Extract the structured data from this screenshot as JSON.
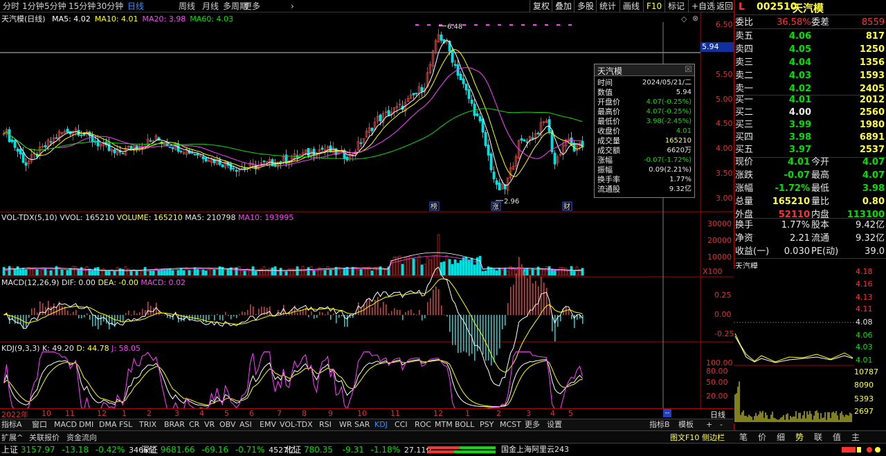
{
  "period_tabs": [
    "分时",
    "1分钟",
    "5分钟",
    "15分钟",
    "30分钟",
    "日线",
    "周线",
    "月线",
    "多周期",
    "更多"
  ],
  "active_period": "日线",
  "right_buttons": [
    "复权",
    "叠加",
    "多股",
    "统计",
    "画线",
    "F10",
    "标记",
    "+自选",
    "返回"
  ],
  "highlight_button": "F10",
  "header": {
    "flag": "L",
    "code": "002510",
    "name": "天汽模"
  },
  "price_chart": {
    "title": "天汽模(日线)",
    "ma": [
      {
        "label": "MA5: 4.02",
        "color": "#ffffff"
      },
      {
        "label": "MA10: 4.01",
        "color": "#ffff00"
      },
      {
        "label": "MA20: 3.98",
        "color": "#ff40ff"
      },
      {
        "label": "MA60: 4.03",
        "color": "#00e000"
      }
    ],
    "y_ticks": [
      "6.50",
      "6.00",
      "5.50",
      "5.00",
      "4.50",
      "4.00",
      "3.50",
      "3.00"
    ],
    "crosshair_value": "5.94",
    "high_marker": "6.48",
    "low_marker": "2.96",
    "event_marks": [
      "榜",
      "涨",
      "财"
    ]
  },
  "volume_chart": {
    "title": "VOL-TDX(5,10)",
    "vvol": "VVOL: 165210",
    "volume": "VOLUME: 165210",
    "ma5": "MA5: 210798",
    "ma10": "MA10: 193995",
    "y_ticks": [
      "30000",
      "20000",
      "10000"
    ],
    "unit": "X100"
  },
  "macd_chart": {
    "title": "MACD(12,26,9)",
    "dif": "DIF: 0.00",
    "dea": "DEA: -0.00",
    "macd": "MACD: 0.02",
    "y_ticks": [
      "0.25",
      "0.00",
      "-0.25"
    ]
  },
  "kdj_chart": {
    "title": "KDJ(9,3,3)",
    "k": "K: 49.20",
    "d": "D: 44.78",
    "j": "J: 58.05",
    "y_ticks": [
      "100.00",
      "80.00",
      "50.00",
      "20.00"
    ]
  },
  "date_axis": [
    "2022年",
    "10",
    "11",
    "12",
    "1",
    "2",
    "3",
    "4",
    "5",
    "6",
    "7",
    "8",
    "9",
    "10",
    "11",
    "12",
    "1",
    "2",
    "3",
    "4",
    "5"
  ],
  "date_axis_right": "日线",
  "tooltip": {
    "title": "天汽模",
    "rows": [
      {
        "k": "时间",
        "v": "2024/05/21/二",
        "c": "#e8e8e8"
      },
      {
        "k": "数值",
        "v": "5.94",
        "c": "#e8e8e8"
      },
      {
        "k": "开盘价",
        "v": "4.07(-0.25%)",
        "c": "#00e000"
      },
      {
        "k": "最高价",
        "v": "4.07(-0.25%)",
        "c": "#00e000"
      },
      {
        "k": "最低价",
        "v": "3.98(-2.45%)",
        "c": "#00e000"
      },
      {
        "k": "收盘价",
        "v": "4.01",
        "c": "#00e000"
      },
      {
        "k": "成交量",
        "v": "165210",
        "c": "#ffff40"
      },
      {
        "k": "成交额",
        "v": "6620万",
        "c": "#e8e8e8"
      },
      {
        "k": "涨幅",
        "v": "-0.07(-1.72%)",
        "c": "#00e000"
      },
      {
        "k": "振幅",
        "v": "0.09(2.21%)",
        "c": "#e8e8e8"
      },
      {
        "k": "换手率",
        "v": "1.77%",
        "c": "#e8e8e8"
      },
      {
        "k": "流通股",
        "v": "9.32亿",
        "c": "#e8e8e8"
      }
    ]
  },
  "quote": {
    "weibi_label": "委比",
    "weibi": "36.58%",
    "weicha_label": "委差",
    "weicha": "8559",
    "sells": [
      {
        "label": "卖五",
        "price": "4.06",
        "vol": "817"
      },
      {
        "label": "卖四",
        "price": "4.05",
        "vol": "1250"
      },
      {
        "label": "卖三",
        "price": "4.04",
        "vol": "1356"
      },
      {
        "label": "卖二",
        "price": "4.03",
        "vol": "1593"
      },
      {
        "label": "卖一",
        "price": "4.02",
        "vol": "2405"
      }
    ],
    "buys": [
      {
        "label": "买一",
        "price": "4.01",
        "vol": "2012"
      },
      {
        "label": "买二",
        "price": "4.00",
        "vol": "2560"
      },
      {
        "label": "买三",
        "price": "3.99",
        "vol": "1980"
      },
      {
        "label": "买四",
        "price": "3.98",
        "vol": "6891"
      },
      {
        "label": "买五",
        "price": "3.97",
        "vol": "2537"
      }
    ],
    "stats": [
      {
        "l1": "现价",
        "v1": "4.01",
        "c1": "#00e000",
        "l2": "今开",
        "v2": "4.07",
        "c2": "#00e000"
      },
      {
        "l1": "涨跌",
        "v1": "-0.07",
        "c1": "#00e000",
        "l2": "最高",
        "v2": "4.07",
        "c2": "#00e000"
      },
      {
        "l1": "涨幅",
        "v1": "-1.72%",
        "c1": "#00e000",
        "l2": "最低",
        "v2": "3.98",
        "c2": "#00e000"
      },
      {
        "l1": "总量",
        "v1": "165210",
        "c1": "#ffff40",
        "l2": "量比",
        "v2": "0.80",
        "c2": "#ffff40"
      },
      {
        "l1": "外盘",
        "v1": "52110",
        "c1": "#ff3232",
        "l2": "内盘",
        "v2": "113100",
        "c2": "#00e000"
      }
    ],
    "stats2": [
      {
        "l1": "换手",
        "v1": "1.77%",
        "c1": "#e8e8e8",
        "l2": "股本",
        "v2": "9.42亿",
        "c2": "#e8e8e8"
      },
      {
        "l1": "净资",
        "v1": "2.21",
        "c1": "#e8e8e8",
        "l2": "流通",
        "v2": "9.32亿",
        "c2": "#e8e8e8"
      },
      {
        "l1": "收益(一)",
        "v1": "0.030",
        "c1": "#e8e8e8",
        "l2": "PE(动)",
        "v2": "39.0",
        "c2": "#e8e8e8"
      }
    ]
  },
  "mini_chart": {
    "title": "天汽模",
    "price_ticks": [
      "4.18",
      "4.16",
      "4.13",
      "4.11",
      "4.08",
      "4.06",
      "4.03",
      "4.01"
    ],
    "vol_ticks": [
      "10787",
      "8090",
      "5393",
      "2697"
    ]
  },
  "indicator_tabs": [
    "指标A",
    "窗口",
    "MACD",
    "DMI",
    "DMA",
    "FSL",
    "TRIX",
    "BRAR",
    "CR",
    "VR",
    "OBV",
    "ASI",
    "EMV",
    "VOL-TDX",
    "RSI",
    "WR",
    "SAR",
    "KDJ",
    "CCI",
    "ROC",
    "MTM",
    "BOLL",
    "PSY",
    "MCST",
    "更多",
    "设置"
  ],
  "active_indicator": "KDJ",
  "indicator_right": [
    "指标B",
    "模板",
    "+",
    "-"
  ],
  "bottom_tabs": [
    "扩展^",
    "关联报价",
    "资金流向"
  ],
  "bottom_right": {
    "f10": "图文F10",
    "side": "侧边栏",
    "tabs": [
      "笔",
      "价",
      "细",
      "势",
      "联",
      "值",
      "主"
    ],
    "active": "势"
  },
  "status": {
    "sh": {
      "name": "上证",
      "value": "3157.97",
      "chg": "-13.18",
      "pct": "-0.42%",
      "amt": "3466亿"
    },
    "sz": {
      "name": "深证",
      "value": "9681.66",
      "chg": "-69.16",
      "pct": "-0.71%",
      "amt": "4527亿"
    },
    "bz": {
      "name": "北证",
      "value": "780.35",
      "chg": "-9.31",
      "pct": "-1.18%",
      "amt": "27.11亿"
    },
    "server": "国金上海阿里云243"
  }
}
